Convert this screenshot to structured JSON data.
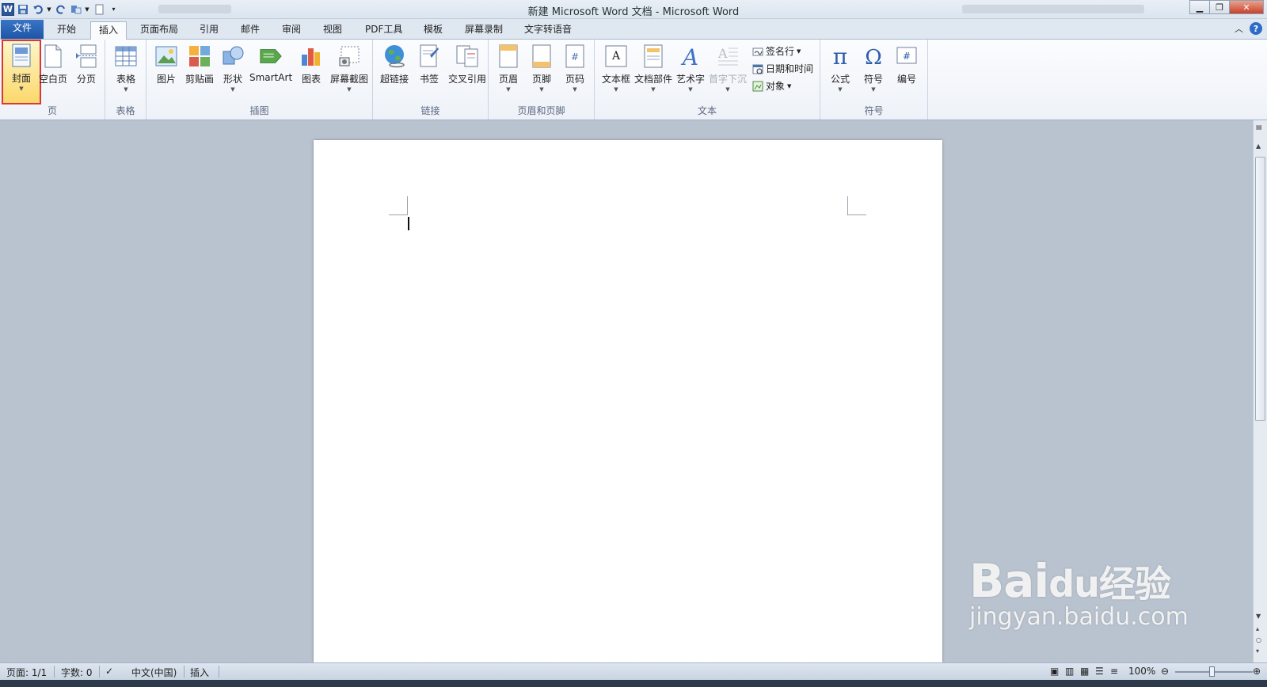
{
  "window": {
    "title": "新建 Microsoft Word 文档 - Microsoft Word",
    "app_icon": "W"
  },
  "tabs": [
    {
      "label": "文件"
    },
    {
      "label": "开始"
    },
    {
      "label": "插入"
    },
    {
      "label": "页面布局"
    },
    {
      "label": "引用"
    },
    {
      "label": "邮件"
    },
    {
      "label": "审阅"
    },
    {
      "label": "视图"
    },
    {
      "label": "PDF工具"
    },
    {
      "label": "模板"
    },
    {
      "label": "屏幕录制"
    },
    {
      "label": "文字转语音"
    }
  ],
  "active_tab": "插入",
  "ribbon": {
    "groups": {
      "page": "页",
      "table": "表格",
      "illustrations": "插图",
      "links": "链接",
      "header_footer": "页眉和页脚",
      "text": "文本",
      "symbols": "符号"
    },
    "buttons": {
      "cover": "封面",
      "blank_page": "空白页",
      "page_break": "分页",
      "table": "表格",
      "picture": "图片",
      "clipart": "剪贴画",
      "shapes": "形状",
      "smartart": "SmartArt",
      "chart": "图表",
      "screenshot": "屏幕截图",
      "hyperlink": "超链接",
      "bookmark": "书签",
      "cross_ref": "交叉引用",
      "header": "页眉",
      "footer": "页脚",
      "page_number": "页码",
      "textbox": "文本框",
      "quick_parts": "文档部件",
      "wordart": "艺术字",
      "dropcap": "首字下沉",
      "signature_line": "签名行",
      "date_time": "日期和时间",
      "object": "对象",
      "equation": "公式",
      "symbol": "符号",
      "numbering": "编号"
    }
  },
  "status": {
    "page": "页面: 1/1",
    "words": "字数: 0",
    "language": "中文(中国)",
    "mode": "插入",
    "zoom": "100%"
  },
  "watermark": {
    "line1": "Bai",
    "line1_b": "经验",
    "line2": "jingyan.baidu.com"
  },
  "colors": {
    "file_tab": "#2b64b8",
    "highlight_border": "#d9363e",
    "highlight_fill": "#fbd86b"
  }
}
